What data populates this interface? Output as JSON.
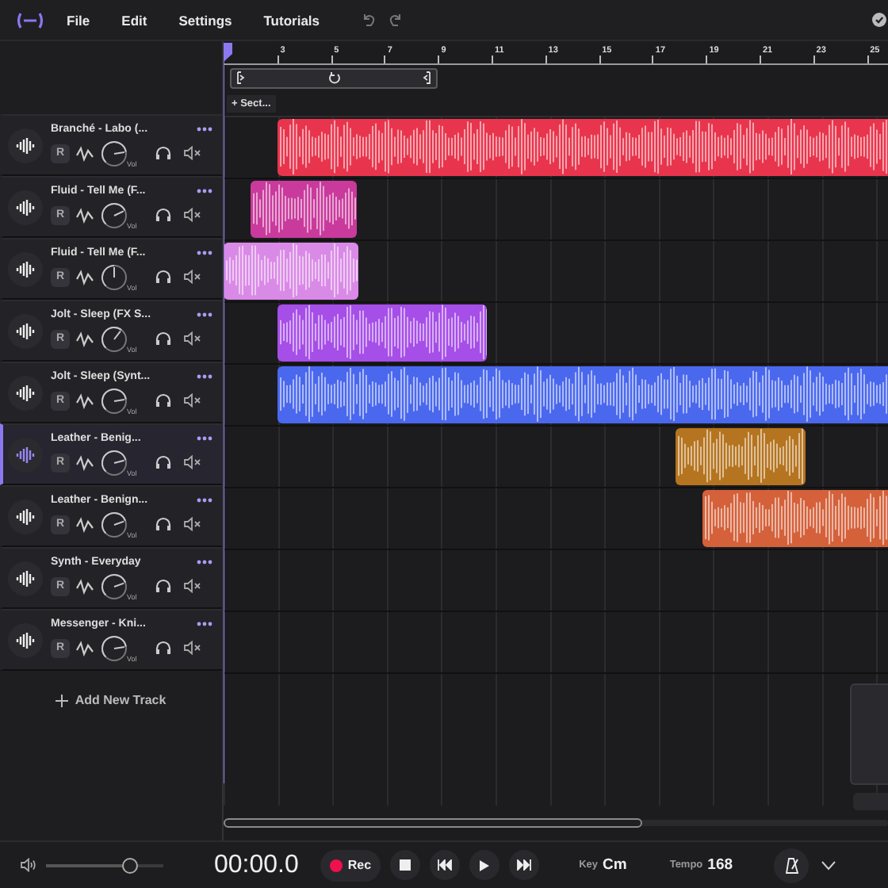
{
  "menu": {
    "items": [
      "File",
      "Edit",
      "Settings",
      "Tutorials"
    ]
  },
  "ruler": {
    "labels": [
      "3",
      "5",
      "7",
      "9",
      "11",
      "13",
      "15",
      "17",
      "19",
      "21",
      "23",
      "25"
    ]
  },
  "section_button": {
    "label": "+ Sect..."
  },
  "tracks": [
    {
      "name": "Branché - Labo (...",
      "selected": false,
      "arm_label": "R",
      "volume_label": "Vol",
      "level": 0.8,
      "clips": [
        {
          "color": "#e8354d"
        }
      ]
    },
    {
      "name": "Fluid - Tell Me (F...",
      "selected": false,
      "arm_label": "R",
      "volume_label": "Vol",
      "level": 0.74,
      "clips": [
        {
          "color": "#c93a9c"
        }
      ]
    },
    {
      "name": "Fluid - Tell Me (F...",
      "selected": false,
      "arm_label": "R",
      "volume_label": "Vol",
      "level": 0.5,
      "clips": [
        {
          "color": "#d98ae6"
        }
      ]
    },
    {
      "name": "Jolt - Sleep (FX S...",
      "selected": false,
      "arm_label": "R",
      "volume_label": "Vol",
      "level": 0.64,
      "clips": [
        {
          "color": "#a64ee8"
        }
      ]
    },
    {
      "name": "Jolt - Sleep (Synt...",
      "selected": false,
      "arm_label": "R",
      "volume_label": "Vol",
      "level": 0.8,
      "clips": [
        {
          "color": "#4a68ee"
        }
      ]
    },
    {
      "name": "Leather - Benig...",
      "selected": true,
      "arm_label": "R",
      "volume_label": "Vol",
      "level": 0.78,
      "clips": [
        {
          "color": "#b5741f"
        }
      ]
    },
    {
      "name": "Leather - Benign...",
      "selected": false,
      "arm_label": "R",
      "volume_label": "Vol",
      "level": 0.76,
      "clips": [
        {
          "color": "#d4613a"
        }
      ]
    },
    {
      "name": "Synth - Everyday",
      "selected": false,
      "arm_label": "R",
      "volume_label": "Vol",
      "level": 0.76
    },
    {
      "name": "Messenger - Kni...",
      "selected": false,
      "arm_label": "R",
      "volume_label": "Vol",
      "level": 0.8
    }
  ],
  "add_track": {
    "label": "Add New Track"
  },
  "transport": {
    "master_volume": {
      "level": 0.72
    },
    "time": "00:00.0",
    "record_label": "Rec",
    "key_label": "Key",
    "key": "Cm",
    "tempo_label": "Tempo",
    "tempo": "168"
  }
}
